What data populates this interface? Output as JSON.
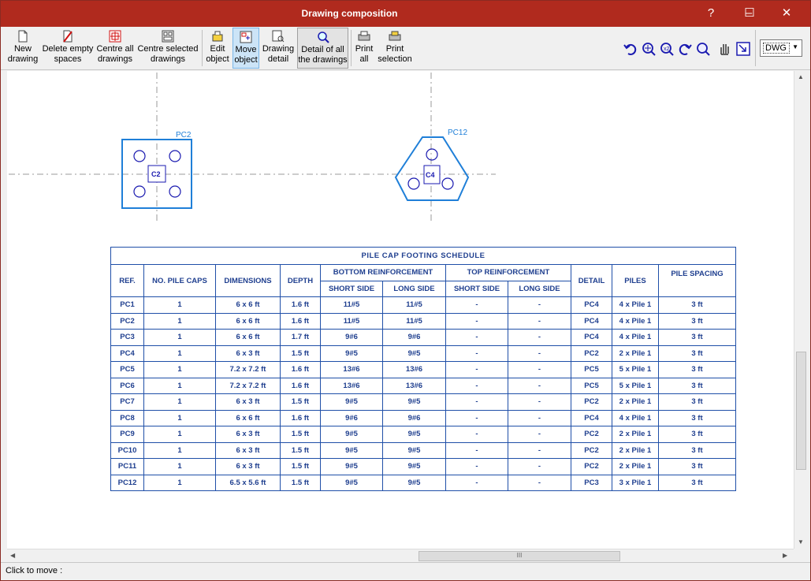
{
  "window": {
    "title": "Drawing composition",
    "help": "?",
    "minimize": "–",
    "maximize": "☐",
    "close": "✕"
  },
  "toolbar": {
    "new_drawing": [
      "New",
      "drawing"
    ],
    "delete_empty": [
      "Delete empty",
      "spaces"
    ],
    "centre_all": [
      "Centre all",
      "drawings"
    ],
    "centre_selected": [
      "Centre selected",
      "drawings"
    ],
    "edit_object": [
      "Edit",
      "object"
    ],
    "move_object": [
      "Move",
      "object"
    ],
    "drawing_detail": [
      "Drawing",
      "detail"
    ],
    "detail_all": [
      "Detail of all",
      "the drawings"
    ],
    "print_all": [
      "Print",
      "all"
    ],
    "print_selection": [
      "Print",
      "selection"
    ],
    "format": "DWG"
  },
  "drawing": {
    "cap1_label": "PC2",
    "cap1_column": "C2",
    "cap2_label": "PC12",
    "cap2_column": "C4"
  },
  "schedule": {
    "title": "PILE CAP FOOTING SCHEDULE",
    "headers": {
      "ref": "REF.",
      "no_caps": "NO. PILE CAPS",
      "dimensions": "DIMENSIONS",
      "depth": "DEPTH",
      "bottom": "BOTTOM  REINFORCEMENT",
      "top": "TOP  REINFORCEMENT",
      "short_side": "SHORT  SIDE",
      "long_side": "LONG SIDE",
      "detail": "DETAIL",
      "piles": "PILES",
      "pile_spacing": "PILE SPACING"
    },
    "rows": [
      [
        "PC1",
        "1",
        "6 x 6 ft",
        "1.6 ft",
        "11#5",
        "11#5",
        "-",
        "-",
        "PC4",
        "4 x Pile 1",
        "3 ft"
      ],
      [
        "PC2",
        "1",
        "6 x 6 ft",
        "1.6 ft",
        "11#5",
        "11#5",
        "-",
        "-",
        "PC4",
        "4 x Pile 1",
        "3 ft"
      ],
      [
        "PC3",
        "1",
        "6 x 6 ft",
        "1.7 ft",
        "9#6",
        "9#6",
        "-",
        "-",
        "PC4",
        "4 x Pile 1",
        "3 ft"
      ],
      [
        "PC4",
        "1",
        "6 x 3 ft",
        "1.5 ft",
        "9#5",
        "9#5",
        "-",
        "-",
        "PC2",
        "2 x Pile 1",
        "3 ft"
      ],
      [
        "PC5",
        "1",
        "7.2 x 7.2 ft",
        "1.6 ft",
        "13#6",
        "13#6",
        "-",
        "-",
        "PC5",
        "5 x Pile 1",
        "3 ft"
      ],
      [
        "PC6",
        "1",
        "7.2 x 7.2 ft",
        "1.6 ft",
        "13#6",
        "13#6",
        "-",
        "-",
        "PC5",
        "5 x Pile 1",
        "3 ft"
      ],
      [
        "PC7",
        "1",
        "6 x 3 ft",
        "1.5 ft",
        "9#5",
        "9#5",
        "-",
        "-",
        "PC2",
        "2 x Pile 1",
        "3 ft"
      ],
      [
        "PC8",
        "1",
        "6 x 6 ft",
        "1.6 ft",
        "9#6",
        "9#6",
        "-",
        "-",
        "PC4",
        "4 x Pile 1",
        "3 ft"
      ],
      [
        "PC9",
        "1",
        "6 x 3 ft",
        "1.5 ft",
        "9#5",
        "9#5",
        "-",
        "-",
        "PC2",
        "2 x Pile 1",
        "3 ft"
      ],
      [
        "PC10",
        "1",
        "6 x 3 ft",
        "1.5 ft",
        "9#5",
        "9#5",
        "-",
        "-",
        "PC2",
        "2 x Pile 1",
        "3 ft"
      ],
      [
        "PC11",
        "1",
        "6 x 3 ft",
        "1.5 ft",
        "9#5",
        "9#5",
        "-",
        "-",
        "PC2",
        "2 x Pile 1",
        "3 ft"
      ],
      [
        "PC12",
        "1",
        "6.5 x 5.6 ft",
        "1.5 ft",
        "9#5",
        "9#5",
        "-",
        "-",
        "PC3",
        "3 x Pile 1",
        "3 ft"
      ]
    ]
  },
  "status": {
    "text": "Click to move :"
  },
  "scroll": {
    "grip": "III"
  },
  "colors": {
    "titlebar": "#b02a1e",
    "drawing_blue": "#1f7fd8",
    "pile_blue": "#1a1ab0",
    "table_text": "#1f3f8f"
  }
}
